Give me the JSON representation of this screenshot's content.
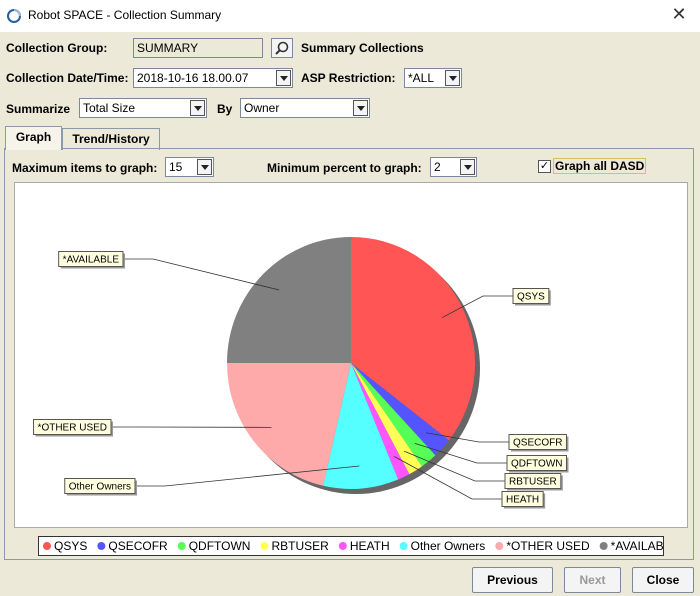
{
  "window": {
    "title": "Robot SPACE - Collection Summary",
    "close_glyph": "✕"
  },
  "form": {
    "collection_group_label": "Collection Group:",
    "collection_group_value": "SUMMARY",
    "summary_collections_label": "Summary Collections",
    "collection_date_label": "Collection Date/Time:",
    "collection_date_value": "2018-10-16  18.00.07",
    "asp_restriction_label": "ASP Restriction:",
    "asp_restriction_value": "*ALL",
    "summarize_label": "Summarize",
    "summarize_value": "Total Size",
    "by_label": "By",
    "by_value": "Owner"
  },
  "tabs": [
    {
      "label": "Graph"
    },
    {
      "label": "Trend/History"
    }
  ],
  "graph_options": {
    "max_items_label": "Maximum items to graph:",
    "max_items_value": "15",
    "min_percent_label": "Minimum percent to graph:",
    "min_percent_value": "2",
    "graph_all_dasd_label": "Graph all DASD",
    "graph_all_dasd_checked": true
  },
  "chart_data": {
    "type": "pie",
    "labels": [
      "QSYS",
      "QSECOFR",
      "QDFTOWN",
      "RBTUSER",
      "HEATH",
      "Other Owners",
      "*OTHER USED",
      "*AVAILABLE"
    ],
    "values": [
      35.5,
      2.6,
      2.2,
      1.9,
      1.6,
      9.8,
      21.4,
      25.0
    ],
    "colors": [
      "#ff5555",
      "#5555ff",
      "#55ff55",
      "#ffff55",
      "#ff55ff",
      "#55ffff",
      "#ffaaaa",
      "#808080"
    ],
    "legend": "bottom"
  },
  "buttons": {
    "previous": "Previous",
    "next": "Next",
    "close": "Close"
  }
}
